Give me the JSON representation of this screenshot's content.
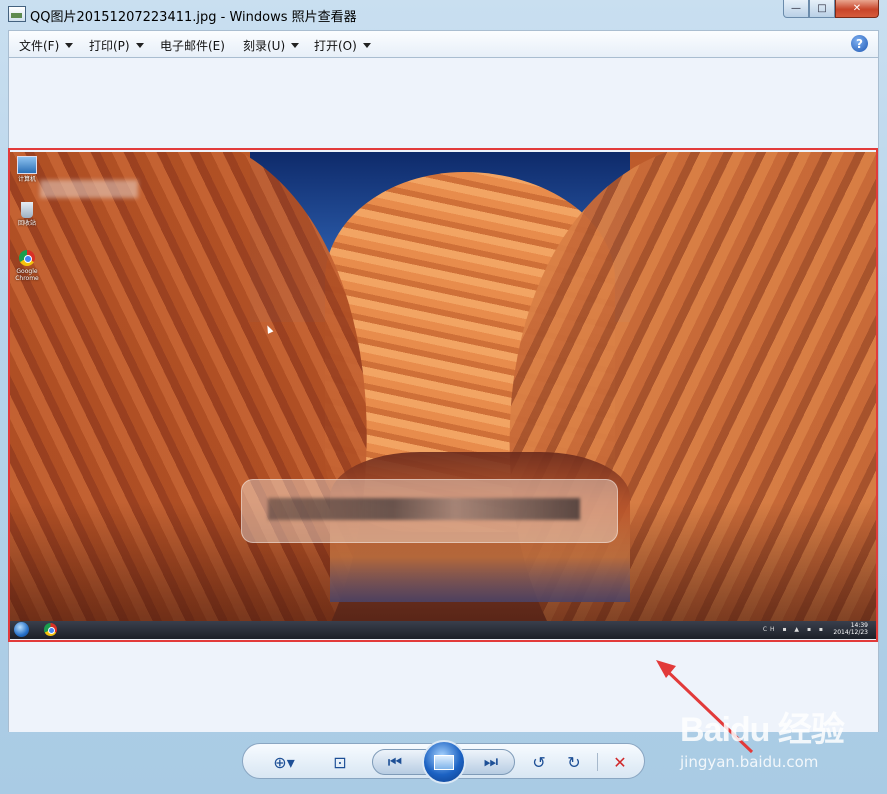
{
  "window": {
    "title": "QQ图片20151207223411.jpg - Windows 照片查看器",
    "caption": {
      "minimize": "—",
      "maximize": "□",
      "close": "✕"
    }
  },
  "menu": {
    "items": [
      {
        "label": "文件(F)",
        "has_arrow": true
      },
      {
        "label": "打印(P)",
        "has_arrow": true
      },
      {
        "label": "电子邮件(E)",
        "has_arrow": false
      },
      {
        "label": "刻录(U)",
        "has_arrow": true
      },
      {
        "label": "打开(O)",
        "has_arrow": true
      }
    ],
    "help": "?"
  },
  "photo": {
    "desktop_icons": [
      {
        "label": "计算机",
        "icon": "computer-icon"
      },
      {
        "label": "回收站",
        "icon": "recycle-bin-icon"
      },
      {
        "label": "Google Chrome",
        "icon": "chrome-icon"
      }
    ],
    "taskbar": {
      "time": "14:39",
      "date": "2014/12/23",
      "tray": "CH ▪ ▲ ▪ ▪"
    }
  },
  "controls": {
    "zoom": "⊕▾",
    "actual_size": "⊡",
    "previous": "⏮",
    "next": "⏭",
    "rotate_ccw": "↺",
    "rotate_cw": "↻",
    "delete": "✕"
  },
  "watermark": {
    "logo": "Baidu 经验",
    "sub": "jingyan.baidu.com"
  },
  "colors": {
    "highlight": "#e23a3a",
    "accent": "#1d4f96"
  }
}
